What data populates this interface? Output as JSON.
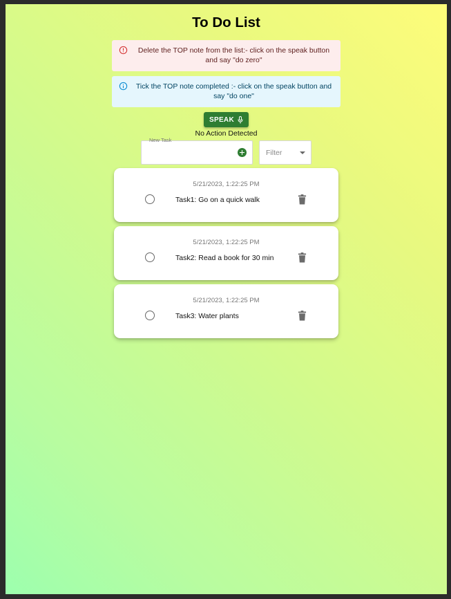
{
  "page": {
    "title": "To Do List"
  },
  "alerts": {
    "error_text": "Delete the TOP note from the list:- click on the speak button and say \"do zero\"",
    "info_text": "Tick the TOP note completed :- click on the speak button and say \"do one\""
  },
  "speak": {
    "label": "SPEAK",
    "status": "No Action Detected"
  },
  "new_task": {
    "label": "New Task",
    "value": ""
  },
  "filter": {
    "label": "Filter"
  },
  "tasks": [
    {
      "timestamp": "5/21/2023, 1:22:25 PM",
      "text": "Task1: Go on a quick walk",
      "completed": false
    },
    {
      "timestamp": "5/21/2023, 1:22:25 PM",
      "text": "Task2: Read a book for 30 min",
      "completed": false
    },
    {
      "timestamp": "5/21/2023, 1:22:25 PM",
      "text": "Task3: Water plants",
      "completed": false
    }
  ],
  "icons": {
    "error": "error-outline-icon",
    "info": "info-outline-icon",
    "mic": "mic-icon",
    "add": "add-circle-icon",
    "dropdown": "arrow-drop-down-icon",
    "unchecked": "radio-unchecked-icon",
    "delete": "trash-icon"
  },
  "colors": {
    "speak_button": "#2e7d32",
    "error_bg": "#fdeded",
    "info_bg": "#e5f6fd",
    "gradient_start": "#fefc7a",
    "gradient_end": "#9dffae"
  }
}
